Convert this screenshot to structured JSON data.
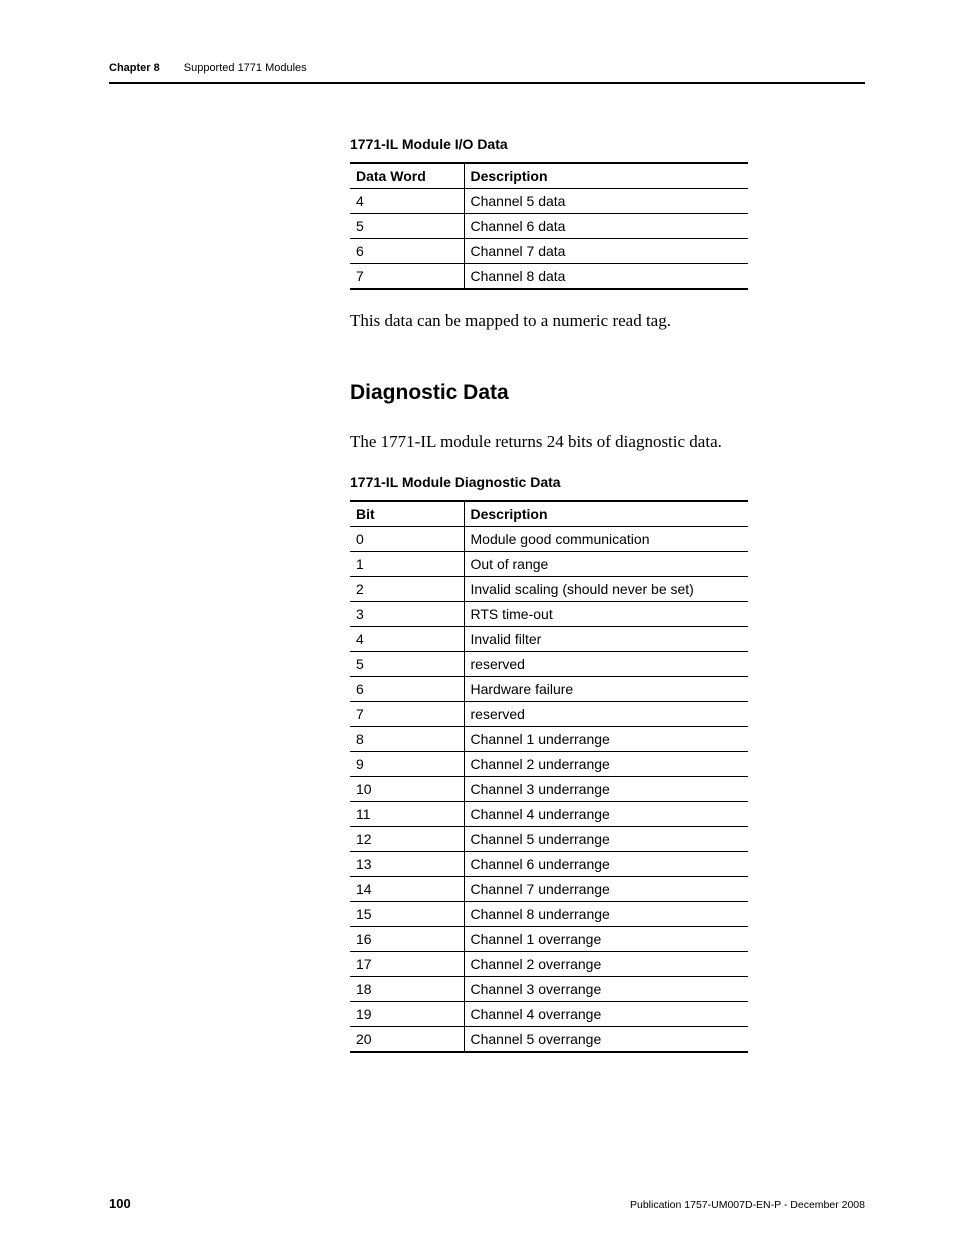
{
  "header": {
    "chapter_label": "Chapter 8",
    "chapter_title": "Supported 1771 Modules"
  },
  "tables": {
    "io_data": {
      "title": "1771-IL Module I/O Data",
      "headers": {
        "col1": "Data Word",
        "col2": "Description"
      },
      "rows": [
        {
          "c1": "4",
          "c2": "Channel 5 data"
        },
        {
          "c1": "5",
          "c2": "Channel 6 data"
        },
        {
          "c1": "6",
          "c2": "Channel 7 data"
        },
        {
          "c1": "7",
          "c2": "Channel 8 data"
        }
      ]
    },
    "diag_data": {
      "title": "1771-IL Module Diagnostic Data",
      "headers": {
        "col1": "Bit",
        "col2": "Description"
      },
      "rows": [
        {
          "c1": "0",
          "c2": "Module good communication"
        },
        {
          "c1": "1",
          "c2": "Out of range"
        },
        {
          "c1": "2",
          "c2": "Invalid scaling (should never be set)"
        },
        {
          "c1": "3",
          "c2": "RTS time-out"
        },
        {
          "c1": "4",
          "c2": "Invalid filter"
        },
        {
          "c1": "5",
          "c2": "reserved"
        },
        {
          "c1": "6",
          "c2": "Hardware failure"
        },
        {
          "c1": "7",
          "c2": "reserved"
        },
        {
          "c1": "8",
          "c2": "Channel 1 underrange"
        },
        {
          "c1": "9",
          "c2": "Channel 2 underrange"
        },
        {
          "c1": "10",
          "c2": "Channel 3 underrange"
        },
        {
          "c1": "11",
          "c2": "Channel 4 underrange"
        },
        {
          "c1": "12",
          "c2": "Channel 5 underrange"
        },
        {
          "c1": "13",
          "c2": "Channel 6 underrange"
        },
        {
          "c1": "14",
          "c2": "Channel 7 underrange"
        },
        {
          "c1": "15",
          "c2": "Channel 8 underrange"
        },
        {
          "c1": "16",
          "c2": "Channel 1 overrange"
        },
        {
          "c1": "17",
          "c2": "Channel 2 overrange"
        },
        {
          "c1": "18",
          "c2": "Channel 3 overrange"
        },
        {
          "c1": "19",
          "c2": "Channel 4 overrange"
        },
        {
          "c1": "20",
          "c2": "Channel 5 overrange"
        }
      ]
    }
  },
  "body": {
    "io_caption": "This data can be mapped to a numeric read tag.",
    "diag_heading": "Diagnostic Data",
    "diag_intro": "The 1771-IL module returns 24 bits of diagnostic data."
  },
  "footer": {
    "page_number": "100",
    "publication": "Publication 1757-UM007D-EN-P - December 2008"
  }
}
